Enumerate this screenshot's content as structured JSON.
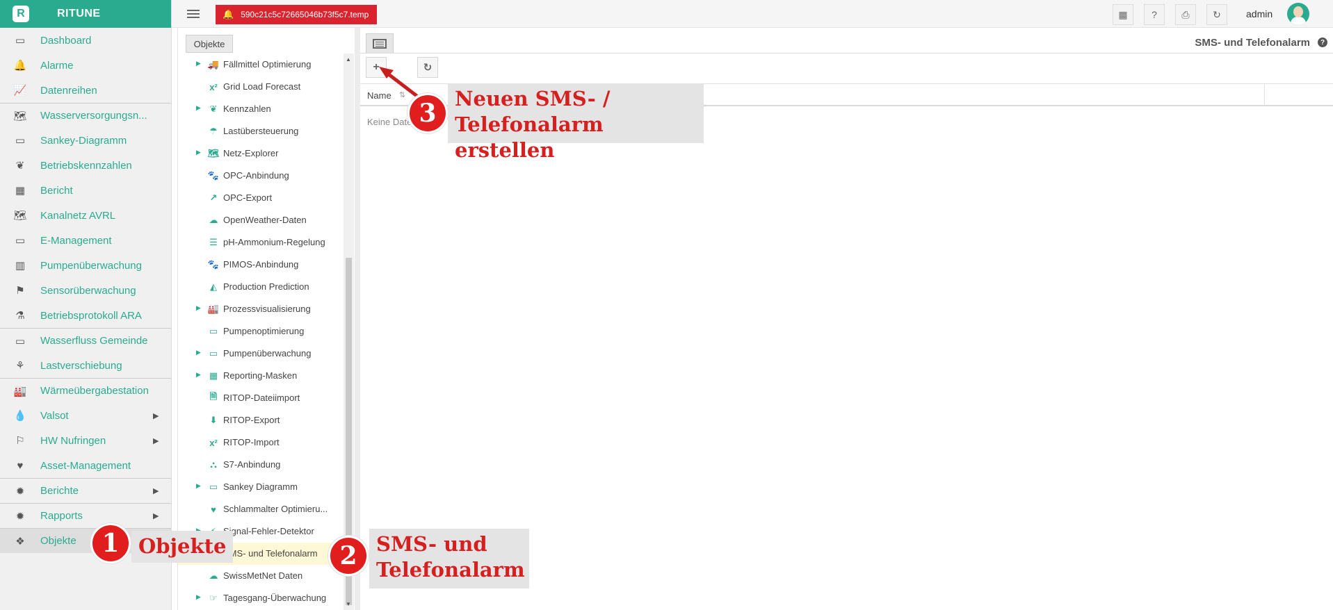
{
  "brand": {
    "name": "RITUNE",
    "logo_letter": "R"
  },
  "sidebar": {
    "items": [
      {
        "label": "Dashboard",
        "icon": "monitor-icon",
        "glyph": "▭",
        "sep": false,
        "caret": false
      },
      {
        "label": "Alarme",
        "icon": "bell-icon",
        "glyph": "🔔",
        "sep": false,
        "caret": false
      },
      {
        "label": "Datenreihen",
        "icon": "line-chart-icon",
        "glyph": "📈",
        "sep": false,
        "caret": false
      },
      {
        "label": "Wasserversorgungsn...",
        "icon": "map-icon",
        "glyph": "🗺",
        "sep": true,
        "caret": false
      },
      {
        "label": "Sankey-Diagramm",
        "icon": "battery-icon",
        "glyph": "▭",
        "sep": false,
        "caret": false
      },
      {
        "label": "Betriebskennzahlen",
        "icon": "leaf-icon",
        "glyph": "❦",
        "sep": false,
        "caret": false
      },
      {
        "label": "Bericht",
        "icon": "table-icon",
        "glyph": "▦",
        "sep": false,
        "caret": false
      },
      {
        "label": "Kanalnetz AVRL",
        "icon": "map-icon",
        "glyph": "🗺",
        "sep": false,
        "caret": false
      },
      {
        "label": "E-Management",
        "icon": "battery-icon",
        "glyph": "▭",
        "sep": false,
        "caret": false
      },
      {
        "label": "Pumpenüberwachung",
        "icon": "barcode-icon",
        "glyph": "▥",
        "sep": false,
        "caret": false
      },
      {
        "label": "Sensorüberwachung",
        "icon": "flag-icon",
        "glyph": "⚑",
        "sep": false,
        "caret": false
      },
      {
        "label": "Betriebsprotokoll ARA",
        "icon": "flask-icon",
        "glyph": "⚗",
        "sep": false,
        "caret": false
      },
      {
        "label": "Wasserfluss Gemeinde",
        "icon": "battery-icon",
        "glyph": "▭",
        "sep": true,
        "caret": false
      },
      {
        "label": "Lastverschiebung",
        "icon": "pagelines-icon",
        "glyph": "⚘",
        "sep": false,
        "caret": false
      },
      {
        "label": "Wärmeübergabestation",
        "icon": "industry-icon",
        "glyph": "🏭",
        "sep": true,
        "caret": false
      },
      {
        "label": "Valsot",
        "icon": "tint-icon",
        "glyph": "💧",
        "sep": false,
        "caret": true
      },
      {
        "label": "HW Nufringen",
        "icon": "signpost-icon",
        "glyph": "⚐",
        "sep": false,
        "caret": true
      },
      {
        "label": "Asset-Management",
        "icon": "heartbeat-icon",
        "glyph": "♥",
        "sep": false,
        "caret": false
      },
      {
        "label": "Berichte",
        "icon": "gear-icon",
        "glyph": "✹",
        "sep": true,
        "caret": true
      },
      {
        "label": "Rapports",
        "icon": "gear-icon",
        "glyph": "✹",
        "sep": true,
        "caret": true
      },
      {
        "label": "Objekte",
        "icon": "cubes-icon",
        "glyph": "❖",
        "sep": true,
        "caret": false,
        "active": true
      }
    ]
  },
  "topbar": {
    "notification": "590c21c5c72665046b73f5c7.temp",
    "buttons": [
      {
        "name": "qrcode-button",
        "glyph": "▦"
      },
      {
        "name": "help-button",
        "glyph": "?"
      },
      {
        "name": "print-button",
        "glyph": "⎙"
      },
      {
        "name": "refresh-button",
        "glyph": "↻"
      }
    ],
    "user": "admin"
  },
  "tree": {
    "tab_label": "Objekte",
    "items": [
      {
        "label": "Fällmittel Optimierung",
        "icon": "truck-icon",
        "glyph": "🚚",
        "expandable": true
      },
      {
        "label": "Grid Load Forecast",
        "icon": "superscript-icon",
        "glyph": "x²",
        "expandable": false
      },
      {
        "label": "Kennzahlen",
        "icon": "leaf-icon",
        "glyph": "❦",
        "expandable": true
      },
      {
        "label": "Lastübersteuerung",
        "icon": "umbrella-icon",
        "glyph": "☂",
        "expandable": false
      },
      {
        "label": "Netz-Explorer",
        "icon": "map-icon",
        "glyph": "🗺",
        "expandable": true
      },
      {
        "label": "OPC-Anbindung",
        "icon": "paw-icon",
        "glyph": "🐾",
        "expandable": false
      },
      {
        "label": "OPC-Export",
        "icon": "share-icon",
        "glyph": "↗",
        "expandable": false
      },
      {
        "label": "OpenWeather-Daten",
        "icon": "cloud-icon",
        "glyph": "☁",
        "expandable": false
      },
      {
        "label": "pH-Ammonium-Regelung",
        "icon": "sliders-icon",
        "glyph": "☰",
        "expandable": false
      },
      {
        "label": "PIMOS-Anbindung",
        "icon": "paw-icon",
        "glyph": "🐾",
        "expandable": false
      },
      {
        "label": "Production Prediction",
        "icon": "area-chart-icon",
        "glyph": "◭",
        "expandable": false
      },
      {
        "label": "Prozessvisualisierung",
        "icon": "industry-icon",
        "glyph": "🏭",
        "expandable": true
      },
      {
        "label": "Pumpenoptimierung",
        "icon": "battery-icon",
        "glyph": "▭",
        "expandable": false
      },
      {
        "label": "Pumpenüberwachung",
        "icon": "battery-icon",
        "glyph": "▭",
        "expandable": true
      },
      {
        "label": "Reporting-Masken",
        "icon": "table-icon",
        "glyph": "▦",
        "expandable": true
      },
      {
        "label": "RITOP-Dateiimport",
        "icon": "file-icon",
        "glyph": "🗎",
        "expandable": false
      },
      {
        "label": "RITOP-Export",
        "icon": "download-icon",
        "glyph": "⬇",
        "expandable": false
      },
      {
        "label": "RITOP-Import",
        "icon": "superscript-icon",
        "glyph": "x²",
        "expandable": false
      },
      {
        "label": "S7-Anbindung",
        "icon": "sitemap-icon",
        "glyph": "⛬",
        "expandable": false
      },
      {
        "label": "Sankey Diagramm",
        "icon": "battery-icon",
        "glyph": "▭",
        "expandable": true
      },
      {
        "label": "Schlammalter Optimieru...",
        "icon": "heart-icon",
        "glyph": "♥",
        "expandable": false
      },
      {
        "label": "Signal-Fehler-Detektor",
        "icon": "bolt-icon",
        "glyph": "⚡",
        "expandable": true
      },
      {
        "label": "SMS- und Telefonalarm",
        "icon": "phone-icon",
        "glyph": "☎",
        "expandable": false,
        "selected": true
      },
      {
        "label": "SwissMetNet Daten",
        "icon": "cloud-icon",
        "glyph": "☁",
        "expandable": false
      },
      {
        "label": "Tagesgang-Überwachung",
        "icon": "hand-point-icon",
        "glyph": "☞",
        "expandable": true
      }
    ]
  },
  "main": {
    "title": "SMS- und Telefonalarm",
    "grid": {
      "column_name": "Name",
      "empty_text": "Keine Daten"
    }
  },
  "annotations": [
    {
      "number": "1",
      "text": "Objekte"
    },
    {
      "number": "2",
      "text": "SMS- und\nTelefonalarm"
    },
    {
      "number": "3",
      "text": "Neuen SMS- /\nTelefonalarm erstellen"
    }
  ],
  "colors": {
    "brand": "#2aab8f",
    "alert": "#d9232e",
    "annotation": "#e01e1e"
  }
}
